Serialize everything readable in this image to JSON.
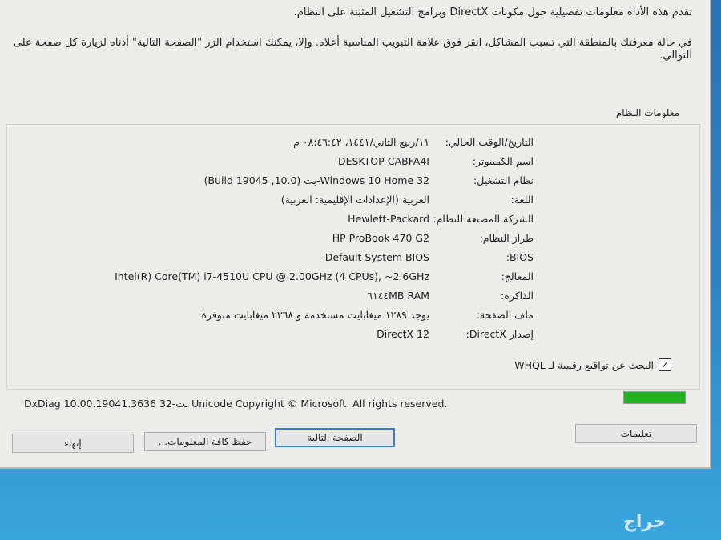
{
  "intro": {
    "line1": "تقدم هذه الأداة معلومات تفصيلية حول مكونات DirectX وبرامج التشغيل المثبتة على النظام.",
    "line2": "في حالة معرفتك بالمنطقة التي تسبب المشاكل، انقر فوق علامة التبويب المناسبة أعلاه. وإلا، يمكنك استخدام الزر \"الصفحة التالية\" أدناه لزيارة كل صفحة على التوالي."
  },
  "section_title": "معلومات النظام",
  "rows": [
    {
      "label": "التاريخ/الوقت الحالي:",
      "value": "١١/ربيع الثاني/١٤٤١، ٠٨:٤٦:٤٢ م"
    },
    {
      "label": "اسم الكمبيوتر:",
      "value": "DESKTOP-CABFA4I"
    },
    {
      "label": "نظام التشغيل:",
      "value": "Windows 10 Home 32-بت (10.0, Build 19045)"
    },
    {
      "label": "اللغة:",
      "value": "العربية (الإعدادات الإقليمية: العربية)"
    },
    {
      "label": "الشركة المصنعة للنظام:",
      "value": "Hewlett-Packard"
    },
    {
      "label": "طراز النظام:",
      "value": "HP ProBook 470 G2"
    },
    {
      "label": "BIOS:",
      "value": "Default System BIOS"
    },
    {
      "label": "المعالج:",
      "value": "Intel(R) Core(TM) i7-4510U CPU @ 2.00GHz (4 CPUs), ~2.6GHz"
    },
    {
      "label": "الذاكرة:",
      "value": "٦١٤٤MB RAM"
    },
    {
      "label": "ملف الصفحة:",
      "value": "يوجد ١٢٨٩ ميغابايت مستخدمة و ٢٣٦٨ ميغابايت متوفرة"
    },
    {
      "label": "إصدار DirectX:",
      "value": "DirectX 12"
    }
  ],
  "whql_check": {
    "label": "البحث عن تواقيع رقمية لـ WHQL",
    "checked": true
  },
  "progress": {
    "fraction": 1.0,
    "color": "#1fb31f"
  },
  "copyright": "DxDiag 10.00.19041.3636 32-بت Unicode  Copyright © Microsoft. All rights reserved.",
  "buttons": {
    "help": "تعليمات",
    "next_page": "الصفحة التالية",
    "save_all": "حفظ كافة المعلومات...",
    "exit": "إنهاء"
  },
  "watermark": "حراج"
}
